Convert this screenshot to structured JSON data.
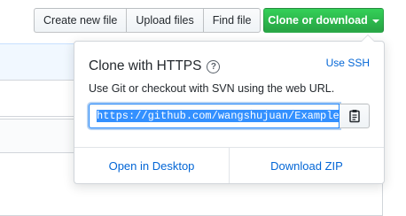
{
  "toolbar": {
    "create_new_file": "Create new file",
    "upload_files": "Upload files",
    "find_file": "Find file",
    "clone_or_download": "Clone or download"
  },
  "clone_dropdown": {
    "title": "Clone with HTTPS",
    "use_ssh": "Use SSH",
    "description": "Use Git or checkout with SVN using the web URL.",
    "url": "https://github.com/wangshujuan/Example.g",
    "open_in_desktop": "Open in Desktop",
    "download_zip": "Download ZIP"
  },
  "icons": {
    "help": "question-circle-icon",
    "copy": "clipboard-icon",
    "caret": "caret-down-icon"
  },
  "colors": {
    "primary_green": "#28a745",
    "link_blue": "#0366d6",
    "selection_blue": "#3390ff",
    "focus_blue": "#2188ff"
  }
}
